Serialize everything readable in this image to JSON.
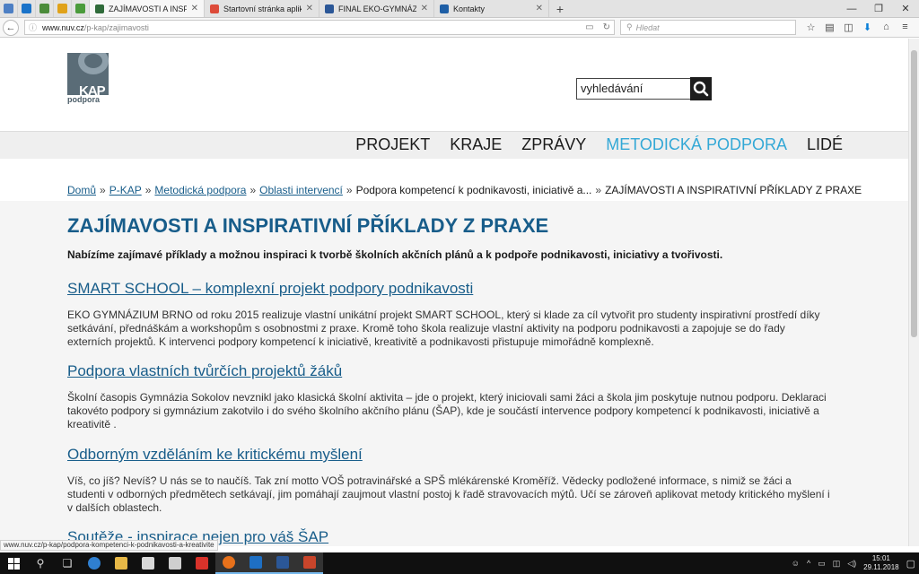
{
  "browser": {
    "pinned_colors": [
      "#4d7fc4",
      "#1a73c9",
      "#4b8c3a",
      "#e0a21a",
      "#4a9b3b"
    ],
    "tabs": [
      {
        "title": "ZAJÍMAVOSTI A INSPIRAT...",
        "color": "#2f6b3a",
        "active": true
      },
      {
        "title": "Startovní stránka aplikace ...",
        "color": "#dd4b39",
        "active": false
      },
      {
        "title": "FINAL EKO-GYMNÁZIUM ...",
        "color": "#2b5797",
        "active": false
      },
      {
        "title": "Kontakty",
        "color": "#1f5fa6",
        "active": false
      }
    ],
    "url_host": "www.nuv.cz",
    "url_path": "/p-kap/zajimavosti",
    "search_placeholder": "Hledat",
    "status_url": "www.nuv.cz/p-kap/podpora-kompetenci-k-podnikavosti-a-kreativite"
  },
  "site": {
    "logo_text": "KAP",
    "logo_sub": "podpora",
    "search_value": "vyhledávání",
    "menu": [
      "PROJEKT",
      "KRAJE",
      "ZPRÁVY",
      "METODICKÁ PODPORA",
      "LIDÉ"
    ],
    "active_menu": "METODICKÁ PODPORA",
    "breadcrumbs": {
      "links": [
        "Domů",
        "P-KAP",
        "Metodická podpora",
        "Oblasti intervencí"
      ],
      "plain": "Podpora kompetencí k podnikavosti, iniciativě a...",
      "current": "ZAJÍMAVOSTI A INSPIRATIVNÍ PŘÍKLADY Z PRAXE"
    },
    "title": "ZAJÍMAVOSTI A INSPIRATIVNÍ PŘÍKLADY Z PRAXE",
    "lead": "Nabízíme zajímavé příklady a možnou inspiraci k tvorbě školních akčních plánů a k podpoře podnikavosti, iniciativy a tvořivosti.",
    "articles": [
      {
        "title": "SMART SCHOOL – komplexní projekt podpory podnikavosti",
        "text": "EKO GYMNÁZIUM BRNO od roku 2015 realizuje vlastní unikátní projekt SMART SCHOOL, který si klade za cíl vytvořit pro studenty inspirativní prostředí díky setkávání, přednáškám a workshopům s osobnostmi z praxe. Kromě toho škola realizuje vlastní aktivity na podporu podnikavosti a zapojuje se do řady externích projektů. K intervenci podpory kompetencí k iniciativě, kreativitě a podnikavosti přistupuje mimořádně komplexně."
      },
      {
        "title": "Podpora vlastních tvůrčích projektů žáků",
        "text": "Školní časopis Gymnázia Sokolov nevznikl jako klasická školní aktivita – jde o projekt, který iniciovali sami žáci a škola jim poskytuje nutnou podporu. Deklaraci takovéto podpory si gymnázium zakotvilo i do svého školního akčního plánu (ŠAP), kde je součástí intervence podpory kompetencí k podnikavosti, iniciativě a kreativitě ."
      },
      {
        "title": "Odborným vzděláním ke kritickému myšlení",
        "text": "Víš, co jíš? Nevíš? U nás se to naučíš. Tak  zní motto VOŠ potravinářské a SPŠ mlékárenské Kroměříž. Vědecky podložené informace, s nimiž se žáci a studenti v odborných předmětech setkávají, jim pomáhají zaujmout vlastní postoj k řadě stravovacích mýtů. Učí se zároveň aplikovat metody kritického myšlení i v dalších oblastech."
      },
      {
        "title": "Soutěže - inspirace nejen pro váš ŠAP",
        "text": ""
      }
    ]
  },
  "taskbar": {
    "time": "15:01",
    "date": "29.11.2018"
  }
}
